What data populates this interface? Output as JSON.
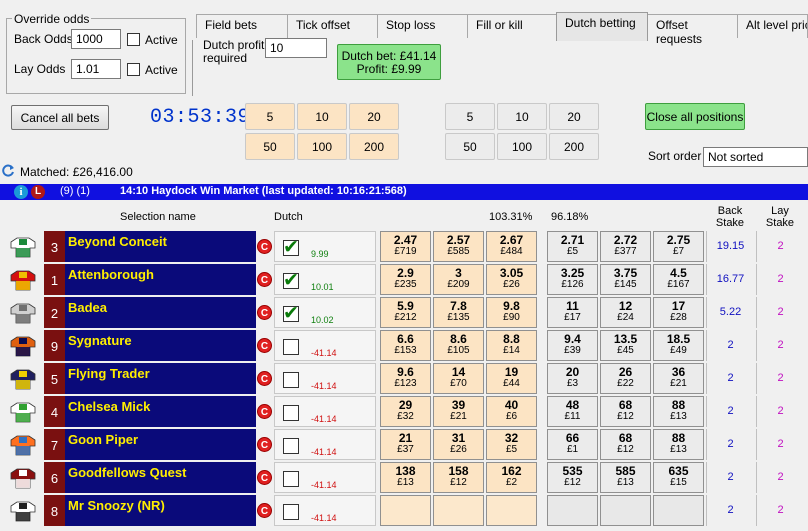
{
  "override": {
    "title": "Override odds",
    "back_label": "Back Odds",
    "back_value": "1000",
    "lay_label": "Lay Odds",
    "lay_value": "1.01",
    "active_label": "Active"
  },
  "tabs": [
    "Field bets",
    "Tick offset",
    "Stop loss",
    "Fill or kill",
    "Dutch betting",
    "Offset requests",
    "Alt level prices"
  ],
  "active_tab": "Dutch betting",
  "dutch": {
    "profit_label_1": "Dutch profit",
    "profit_label_2": "required",
    "profit_value": "10",
    "bet_line": "Dutch bet: £41.14",
    "profit_line": "Profit: £9.99"
  },
  "toolbar": {
    "cancel_label": "Cancel all bets",
    "timer": "03:53:39",
    "close_label": "Close all positions",
    "sort_label": "Sort order",
    "sort_value": "Not sorted",
    "matched": "Matched: £26,416.00"
  },
  "stakes_left": [
    "5",
    "10",
    "20",
    "50",
    "100",
    "200"
  ],
  "stakes_right": [
    "5",
    "10",
    "20",
    "50",
    "100",
    "200"
  ],
  "market": {
    "counts": "(9) (1)",
    "title": "14:10 Haydock Win Market (last updated: 10:16:21:568)"
  },
  "headers": {
    "selection": "Selection name",
    "dutch": "Dutch",
    "back_book": "103.31%",
    "lay_book": "96.18%",
    "back_stake_1": "Back",
    "back_stake_2": "Stake",
    "lay_stake_1": "Lay",
    "lay_stake_2": "Stake"
  },
  "runners": [
    {
      "num": "3",
      "name": "Beyond Conceit",
      "checked": true,
      "pnl": "9.99",
      "pnl_sign": "pos",
      "back": [
        [
          "2.47",
          "£719"
        ],
        [
          "2.57",
          "£585"
        ],
        [
          "2.67",
          "£484"
        ]
      ],
      "lay": [
        [
          "2.71",
          "£5"
        ],
        [
          "2.72",
          "£377"
        ],
        [
          "2.75",
          "£7"
        ]
      ],
      "back_stake": "19.15",
      "lay_stake": "2"
    },
    {
      "num": "1",
      "name": "Attenborough",
      "checked": true,
      "pnl": "10.01",
      "pnl_sign": "pos",
      "back": [
        [
          "2.9",
          "£235"
        ],
        [
          "3",
          "£209"
        ],
        [
          "3.05",
          "£26"
        ]
      ],
      "lay": [
        [
          "3.25",
          "£126"
        ],
        [
          "3.75",
          "£145"
        ],
        [
          "4.5",
          "£167"
        ]
      ],
      "back_stake": "16.77",
      "lay_stake": "2"
    },
    {
      "num": "2",
      "name": "Badea",
      "checked": true,
      "pnl": "10.02",
      "pnl_sign": "pos",
      "back": [
        [
          "5.9",
          "£212"
        ],
        [
          "7.8",
          "£135"
        ],
        [
          "9.8",
          "£90"
        ]
      ],
      "lay": [
        [
          "11",
          "£17"
        ],
        [
          "12",
          "£24"
        ],
        [
          "17",
          "£28"
        ]
      ],
      "back_stake": "5.22",
      "lay_stake": "2"
    },
    {
      "num": "9",
      "name": "Sygnature",
      "checked": false,
      "pnl": "-41.14",
      "pnl_sign": "neg",
      "back": [
        [
          "6.6",
          "£153"
        ],
        [
          "8.6",
          "£105"
        ],
        [
          "8.8",
          "£14"
        ]
      ],
      "lay": [
        [
          "9.4",
          "£39"
        ],
        [
          "13.5",
          "£45"
        ],
        [
          "18.5",
          "£49"
        ]
      ],
      "back_stake": "2",
      "lay_stake": "2"
    },
    {
      "num": "5",
      "name": "Flying Trader",
      "checked": false,
      "pnl": "-41.14",
      "pnl_sign": "neg",
      "back": [
        [
          "9.6",
          "£123"
        ],
        [
          "14",
          "£70"
        ],
        [
          "19",
          "£44"
        ]
      ],
      "lay": [
        [
          "20",
          "£3"
        ],
        [
          "26",
          "£22"
        ],
        [
          "36",
          "£21"
        ]
      ],
      "back_stake": "2",
      "lay_stake": "2"
    },
    {
      "num": "4",
      "name": "Chelsea Mick",
      "checked": false,
      "pnl": "-41.14",
      "pnl_sign": "neg",
      "back": [
        [
          "29",
          "£32"
        ],
        [
          "39",
          "£21"
        ],
        [
          "40",
          "£6"
        ]
      ],
      "lay": [
        [
          "48",
          "£11"
        ],
        [
          "68",
          "£12"
        ],
        [
          "88",
          "£13"
        ]
      ],
      "back_stake": "2",
      "lay_stake": "2"
    },
    {
      "num": "7",
      "name": "Goon Piper",
      "checked": false,
      "pnl": "-41.14",
      "pnl_sign": "neg",
      "back": [
        [
          "21",
          "£37"
        ],
        [
          "31",
          "£26"
        ],
        [
          "32",
          "£5"
        ]
      ],
      "lay": [
        [
          "66",
          "£1"
        ],
        [
          "68",
          "£12"
        ],
        [
          "88",
          "£13"
        ]
      ],
      "back_stake": "2",
      "lay_stake": "2"
    },
    {
      "num": "6",
      "name": "Goodfellows Quest",
      "checked": false,
      "pnl": "-41.14",
      "pnl_sign": "neg",
      "back": [
        [
          "138",
          "£13"
        ],
        [
          "158",
          "£12"
        ],
        [
          "162",
          "£2"
        ]
      ],
      "lay": [
        [
          "535",
          "£12"
        ],
        [
          "585",
          "£13"
        ],
        [
          "635",
          "£15"
        ]
      ],
      "back_stake": "2",
      "lay_stake": "2"
    },
    {
      "num": "8",
      "name": "Mr Snoozy (NR)",
      "checked": false,
      "pnl": "-41.14",
      "pnl_sign": "neg",
      "back": [
        [
          "",
          ""
        ],
        [
          "",
          ""
        ],
        [
          "",
          ""
        ]
      ],
      "lay": [
        [
          "",
          ""
        ],
        [
          "",
          ""
        ],
        [
          "",
          ""
        ]
      ],
      "back_stake": "2",
      "lay_stake": "2"
    }
  ],
  "silk_colors": [
    [
      "#ffffff",
      "#1a8a3a"
    ],
    [
      "#d41010",
      "#f0c000"
    ],
    [
      "#d0d0d0",
      "#707070"
    ],
    [
      "#e06010",
      "#0a0a50"
    ],
    [
      "#202060",
      "#f0d000"
    ],
    [
      "#ffffff",
      "#30a030"
    ],
    [
      "#ff7020",
      "#3070c0"
    ],
    [
      "#8a1010",
      "#ffffff"
    ],
    [
      "#ffffff",
      "#202020"
    ]
  ]
}
